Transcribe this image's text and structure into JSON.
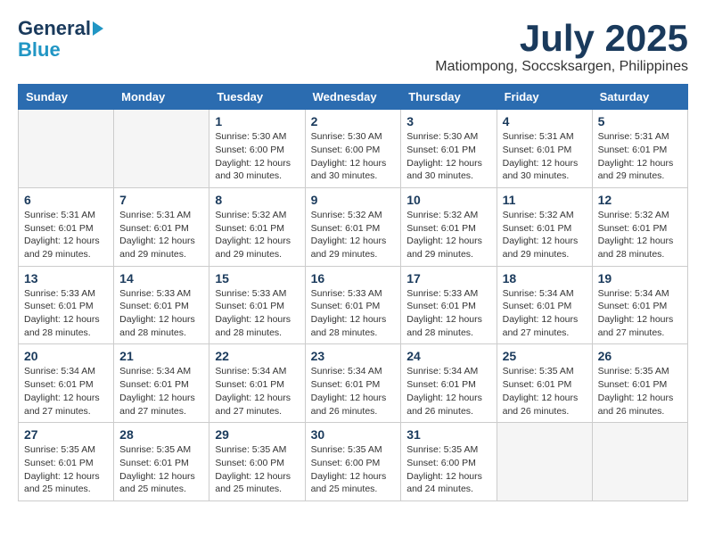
{
  "header": {
    "logo_line1": "General",
    "logo_line2": "Blue",
    "month": "July 2025",
    "location": "Matiompong, Soccsksargen, Philippines"
  },
  "weekdays": [
    "Sunday",
    "Monday",
    "Tuesday",
    "Wednesday",
    "Thursday",
    "Friday",
    "Saturday"
  ],
  "weeks": [
    [
      {
        "day": "",
        "info": ""
      },
      {
        "day": "",
        "info": ""
      },
      {
        "day": "1",
        "info": "Sunrise: 5:30 AM\nSunset: 6:00 PM\nDaylight: 12 hours and 30 minutes."
      },
      {
        "day": "2",
        "info": "Sunrise: 5:30 AM\nSunset: 6:00 PM\nDaylight: 12 hours and 30 minutes."
      },
      {
        "day": "3",
        "info": "Sunrise: 5:30 AM\nSunset: 6:01 PM\nDaylight: 12 hours and 30 minutes."
      },
      {
        "day": "4",
        "info": "Sunrise: 5:31 AM\nSunset: 6:01 PM\nDaylight: 12 hours and 30 minutes."
      },
      {
        "day": "5",
        "info": "Sunrise: 5:31 AM\nSunset: 6:01 PM\nDaylight: 12 hours and 29 minutes."
      }
    ],
    [
      {
        "day": "6",
        "info": "Sunrise: 5:31 AM\nSunset: 6:01 PM\nDaylight: 12 hours and 29 minutes."
      },
      {
        "day": "7",
        "info": "Sunrise: 5:31 AM\nSunset: 6:01 PM\nDaylight: 12 hours and 29 minutes."
      },
      {
        "day": "8",
        "info": "Sunrise: 5:32 AM\nSunset: 6:01 PM\nDaylight: 12 hours and 29 minutes."
      },
      {
        "day": "9",
        "info": "Sunrise: 5:32 AM\nSunset: 6:01 PM\nDaylight: 12 hours and 29 minutes."
      },
      {
        "day": "10",
        "info": "Sunrise: 5:32 AM\nSunset: 6:01 PM\nDaylight: 12 hours and 29 minutes."
      },
      {
        "day": "11",
        "info": "Sunrise: 5:32 AM\nSunset: 6:01 PM\nDaylight: 12 hours and 29 minutes."
      },
      {
        "day": "12",
        "info": "Sunrise: 5:32 AM\nSunset: 6:01 PM\nDaylight: 12 hours and 28 minutes."
      }
    ],
    [
      {
        "day": "13",
        "info": "Sunrise: 5:33 AM\nSunset: 6:01 PM\nDaylight: 12 hours and 28 minutes."
      },
      {
        "day": "14",
        "info": "Sunrise: 5:33 AM\nSunset: 6:01 PM\nDaylight: 12 hours and 28 minutes."
      },
      {
        "day": "15",
        "info": "Sunrise: 5:33 AM\nSunset: 6:01 PM\nDaylight: 12 hours and 28 minutes."
      },
      {
        "day": "16",
        "info": "Sunrise: 5:33 AM\nSunset: 6:01 PM\nDaylight: 12 hours and 28 minutes."
      },
      {
        "day": "17",
        "info": "Sunrise: 5:33 AM\nSunset: 6:01 PM\nDaylight: 12 hours and 28 minutes."
      },
      {
        "day": "18",
        "info": "Sunrise: 5:34 AM\nSunset: 6:01 PM\nDaylight: 12 hours and 27 minutes."
      },
      {
        "day": "19",
        "info": "Sunrise: 5:34 AM\nSunset: 6:01 PM\nDaylight: 12 hours and 27 minutes."
      }
    ],
    [
      {
        "day": "20",
        "info": "Sunrise: 5:34 AM\nSunset: 6:01 PM\nDaylight: 12 hours and 27 minutes."
      },
      {
        "day": "21",
        "info": "Sunrise: 5:34 AM\nSunset: 6:01 PM\nDaylight: 12 hours and 27 minutes."
      },
      {
        "day": "22",
        "info": "Sunrise: 5:34 AM\nSunset: 6:01 PM\nDaylight: 12 hours and 27 minutes."
      },
      {
        "day": "23",
        "info": "Sunrise: 5:34 AM\nSunset: 6:01 PM\nDaylight: 12 hours and 26 minutes."
      },
      {
        "day": "24",
        "info": "Sunrise: 5:34 AM\nSunset: 6:01 PM\nDaylight: 12 hours and 26 minutes."
      },
      {
        "day": "25",
        "info": "Sunrise: 5:35 AM\nSunset: 6:01 PM\nDaylight: 12 hours and 26 minutes."
      },
      {
        "day": "26",
        "info": "Sunrise: 5:35 AM\nSunset: 6:01 PM\nDaylight: 12 hours and 26 minutes."
      }
    ],
    [
      {
        "day": "27",
        "info": "Sunrise: 5:35 AM\nSunset: 6:01 PM\nDaylight: 12 hours and 25 minutes."
      },
      {
        "day": "28",
        "info": "Sunrise: 5:35 AM\nSunset: 6:01 PM\nDaylight: 12 hours and 25 minutes."
      },
      {
        "day": "29",
        "info": "Sunrise: 5:35 AM\nSunset: 6:00 PM\nDaylight: 12 hours and 25 minutes."
      },
      {
        "day": "30",
        "info": "Sunrise: 5:35 AM\nSunset: 6:00 PM\nDaylight: 12 hours and 25 minutes."
      },
      {
        "day": "31",
        "info": "Sunrise: 5:35 AM\nSunset: 6:00 PM\nDaylight: 12 hours and 24 minutes."
      },
      {
        "day": "",
        "info": ""
      },
      {
        "day": "",
        "info": ""
      }
    ]
  ]
}
